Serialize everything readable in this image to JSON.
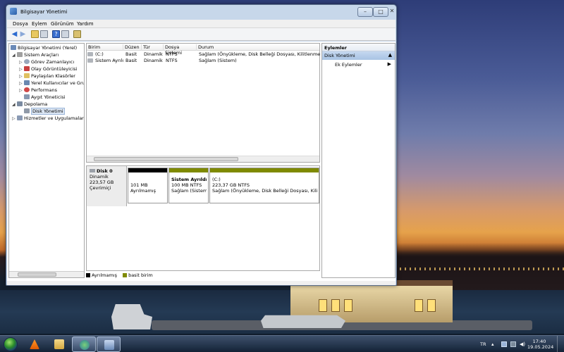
{
  "window": {
    "title": "Bilgisayar Yönetimi"
  },
  "menu": [
    "Dosya",
    "Eylem",
    "Görünüm",
    "Yardım"
  ],
  "tree": {
    "root": "Bilgisayar Yönetimi (Yerel)",
    "items": [
      {
        "label": "Sistem Araçları"
      },
      {
        "label": "Görev Zamanlayıcı"
      },
      {
        "label": "Olay Görüntüleyicisi"
      },
      {
        "label": "Paylaşılan Klasörler"
      },
      {
        "label": "Yerel Kullanıcılar ve Gru"
      },
      {
        "label": "Performans"
      },
      {
        "label": "Aygıt Yöneticisi"
      },
      {
        "label": "Depolama"
      },
      {
        "label": "Disk Yönetimi"
      },
      {
        "label": "Hizmetler ve Uygulamalar"
      }
    ]
  },
  "volumes": {
    "columns": [
      "Birim",
      "Düzen",
      "Tür",
      "Dosya Sistemi",
      "Durum"
    ],
    "rows": [
      [
        "(C:)",
        "Basit",
        "Dinamik",
        "NTFS",
        "Sağlam (Önyükleme, Disk Belleği Dosyası, Kilitlenme Bilgisi"
      ],
      [
        "Sistem Ayrıldı",
        "Basit",
        "Dinamik",
        "NTFS",
        "Sağlam (Sistem)"
      ]
    ]
  },
  "disk": {
    "name": "Disk 0",
    "type": "Dinamik",
    "size": "223,57 GB",
    "status": "Çevrimiçi",
    "partitions": [
      {
        "title": "",
        "line1": "101 MB",
        "line2": "Ayrılmamış",
        "color": "#000000"
      },
      {
        "title": "Sistem Ayrıldı",
        "line1": "100 MB NTFS",
        "line2": "Sağlam (Sistem)",
        "color": "#7f8a00"
      },
      {
        "title": "(C:)",
        "line1": "223,37 GB NTFS",
        "line2": "Sağlam (Önyükleme, Disk Belleği Dosyası, Kilitlenme",
        "color": "#7f8a00"
      }
    ]
  },
  "legend": [
    {
      "label": "Ayrılmamış",
      "color": "#000000"
    },
    {
      "label": "basit birim",
      "color": "#7f8a00"
    }
  ],
  "actions": {
    "header": "Eylemler",
    "section": "Disk Yönetimi",
    "items": [
      "Ek Eylemler"
    ]
  },
  "taskbar": {
    "language": "TR",
    "time": "17:40",
    "date": "19.05.2024"
  }
}
